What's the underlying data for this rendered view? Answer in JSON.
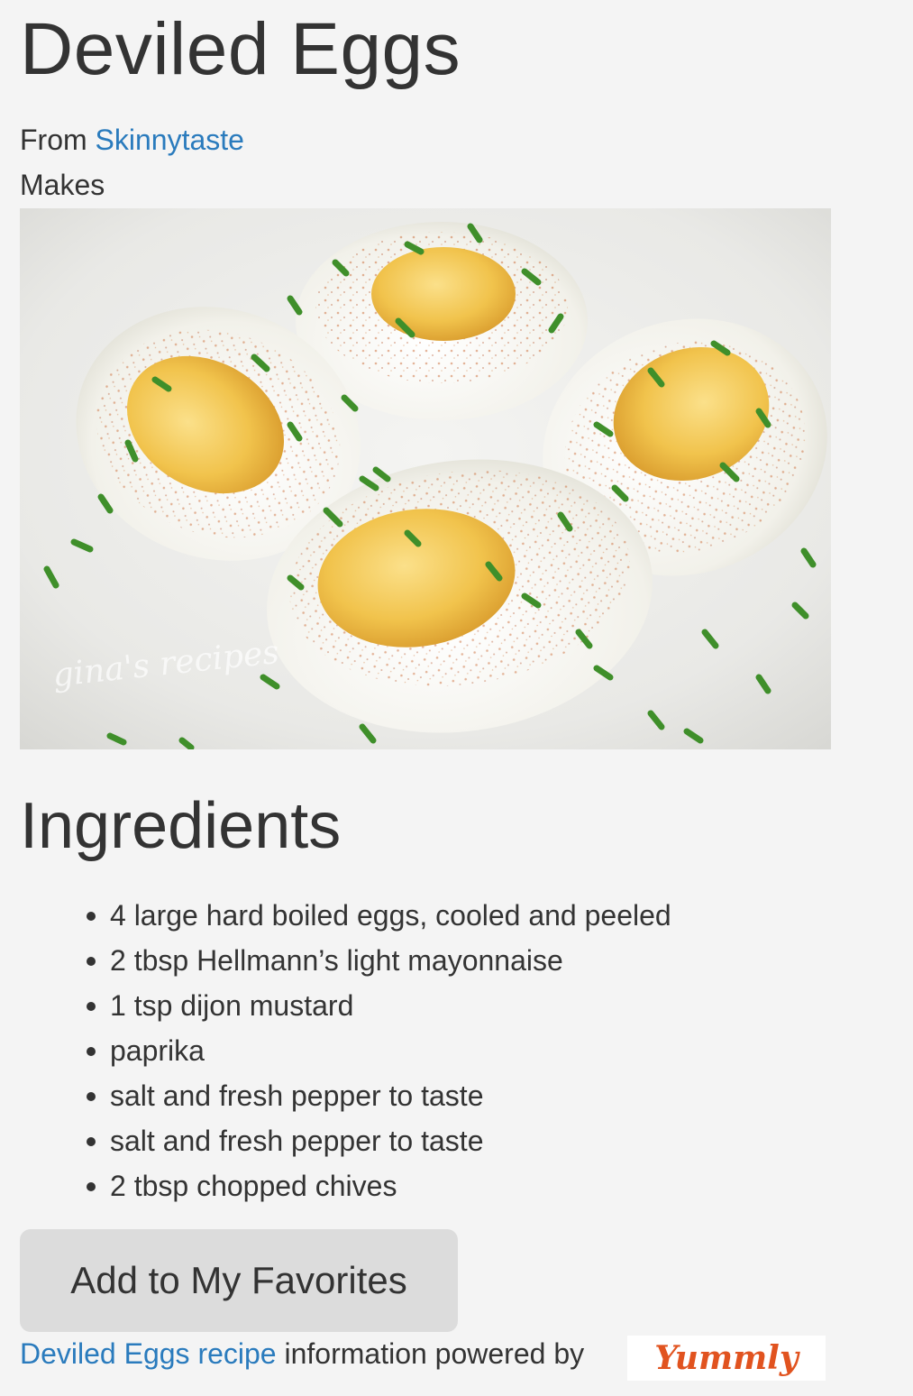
{
  "recipe": {
    "title": "Deviled Eggs",
    "source_prefix": "From",
    "source_name": "Skinnytaste",
    "makes_label": "Makes",
    "photo_watermark": "gina's recipes"
  },
  "ingredients": {
    "heading": "Ingredients",
    "items": [
      "4 large hard boiled eggs, cooled and peeled",
      "2 tbsp Hellmann’s light mayonnaise",
      "1 tsp dijon mustard",
      "paprika",
      "salt and fresh pepper to taste",
      "salt and fresh pepper to taste",
      "2 tbsp chopped chives"
    ]
  },
  "actions": {
    "favorite_label": "Add to My Favorites"
  },
  "attribution": {
    "link_text": "Deviled Eggs recipe",
    "suffix": "information powered by",
    "logo_text": "Yummly"
  },
  "colors": {
    "background": "#f4f4f4",
    "text": "#333333",
    "link": "#2a7bbd",
    "button_bg": "#dcdcdc",
    "yummly_orange": "#e1531f",
    "chive_green": "#3f8f2a",
    "yolk": "#f1c34c",
    "paprika": "#c9652e"
  }
}
